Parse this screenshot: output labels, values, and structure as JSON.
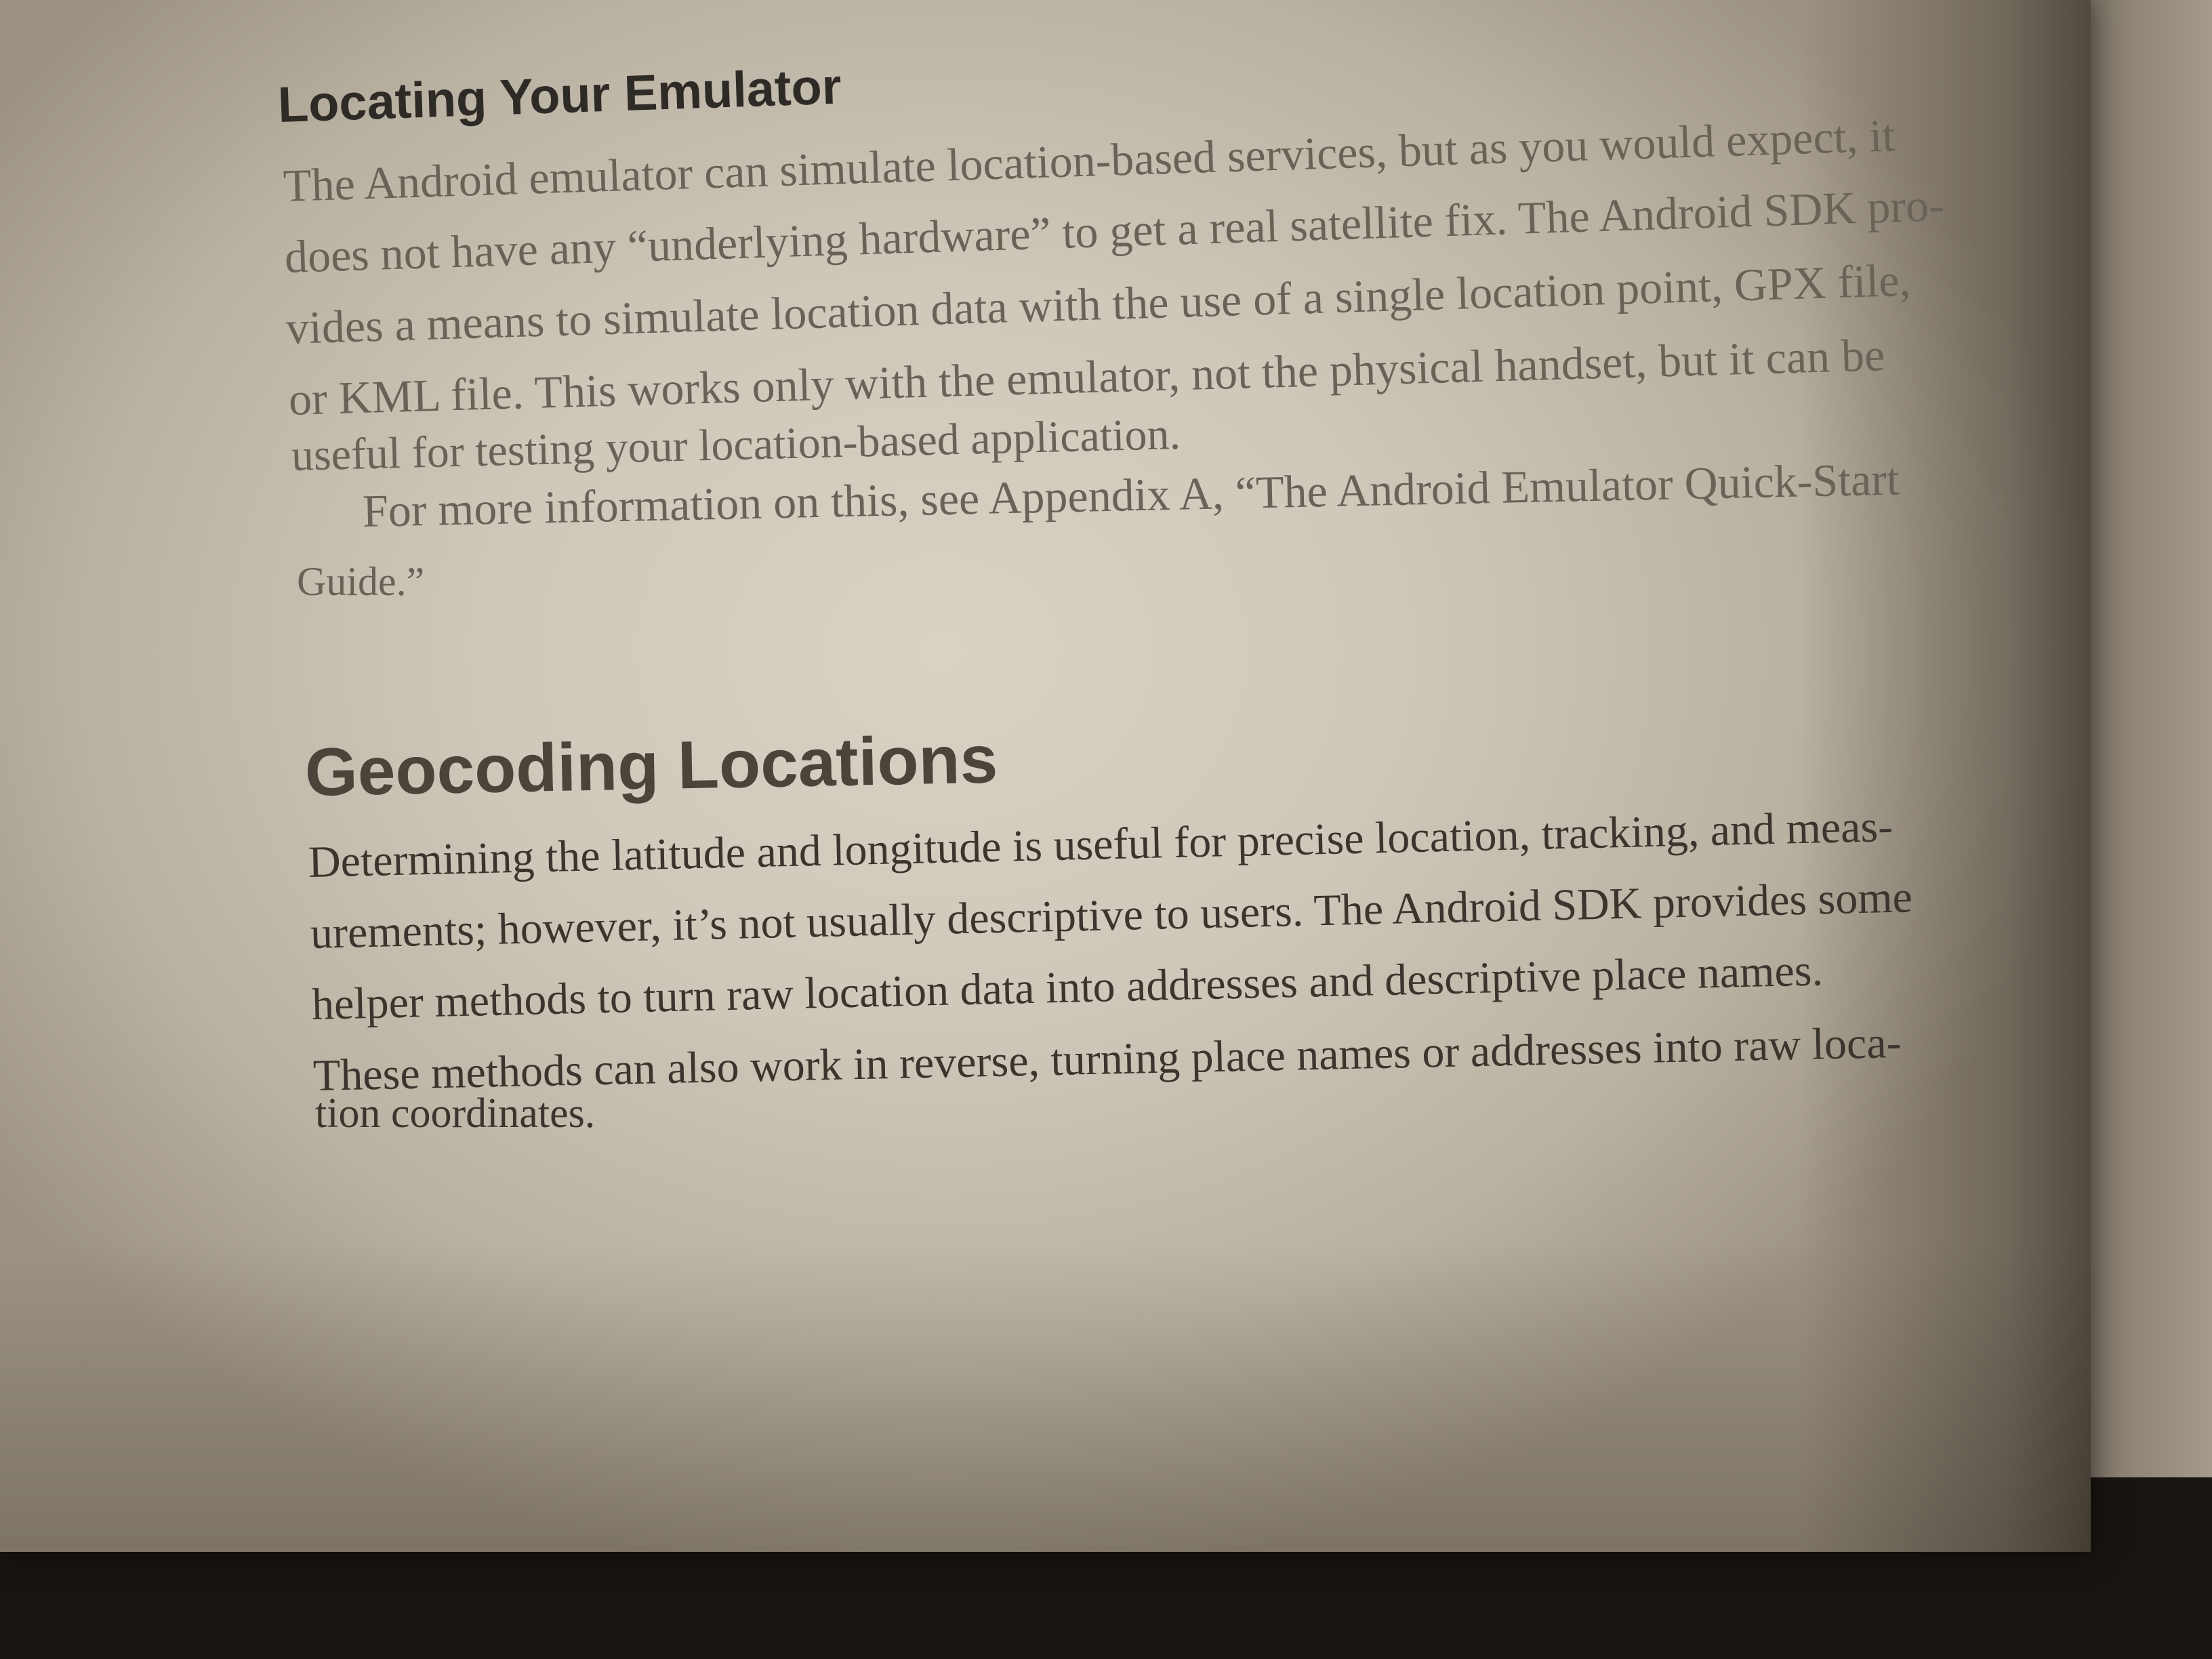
{
  "section1": {
    "heading": "Locating Your Emulator",
    "lines": [
      "The Android emulator can simulate location-based services, but as you would expect, it",
      "does not have any “underlying hardware” to get a real satellite fix. The Android SDK pro-",
      "vides a means to simulate location data with the use of a single location point, GPX file,",
      "or KML file. This works only with the emulator, not the physical handset, but it can be",
      "useful for testing your location-based application."
    ],
    "para2_lines": [
      "For more information on this, see Appendix A, “The Android Emulator Quick-Start",
      "Guide.”"
    ]
  },
  "section2": {
    "heading": "Geocoding Locations",
    "lines": [
      "Determining the latitude and longitude is useful for precise location, tracking, and meas-",
      "urements; however, it’s not usually descriptive to users. The Android SDK provides some",
      "helper methods to turn raw location data into addresses and descriptive place names.",
      "These methods can also work in reverse, turning place names or addresses into raw loca-",
      "tion coordinates."
    ]
  }
}
